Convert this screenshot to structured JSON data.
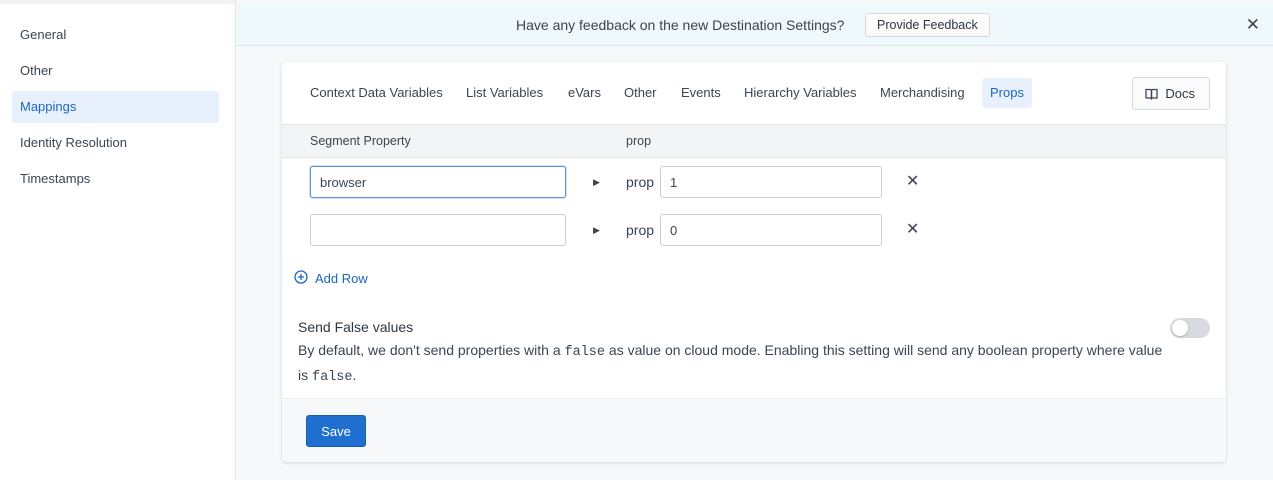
{
  "sidebar": {
    "items": [
      {
        "label": "General",
        "active": false
      },
      {
        "label": "Other",
        "active": false
      },
      {
        "label": "Mappings",
        "active": true
      },
      {
        "label": "Identity Resolution",
        "active": false
      },
      {
        "label": "Timestamps",
        "active": false
      }
    ]
  },
  "banner": {
    "text": "Have any feedback on the new Destination Settings?",
    "button_label": "Provide Feedback",
    "close_glyph": "✕"
  },
  "tabs": {
    "items": [
      {
        "label": "Context Data Variables"
      },
      {
        "label": "List Variables"
      },
      {
        "label": "eVars"
      },
      {
        "label": "Other"
      },
      {
        "label": "Events"
      },
      {
        "label": "Hierarchy Variables"
      },
      {
        "label": "Merchandising"
      },
      {
        "label": "Props",
        "active": true
      }
    ],
    "docs_label": "Docs"
  },
  "table": {
    "col_segment": "Segment Property",
    "col_prop": "prop",
    "rows": [
      {
        "segment_value": "browser",
        "prop_prefix": "prop",
        "prop_value": "1"
      },
      {
        "segment_value": "",
        "prop_prefix": "prop",
        "prop_value": "0"
      }
    ],
    "add_row_label": "Add Row"
  },
  "setting": {
    "title": "Send False values",
    "desc_1": "By default, we don't send properties with a ",
    "desc_code_1": "false",
    "desc_2": " as value on cloud mode. Enabling this setting will send any boolean property where value is ",
    "desc_code_2": "false",
    "desc_3": ".",
    "enabled": false
  },
  "footer": {
    "save_label": "Save"
  },
  "colors": {
    "accent": "#1b67bd",
    "primary_button": "#1f6fd0",
    "banner_bg": "#eff9fb",
    "active_bg": "#e8f1fb"
  }
}
